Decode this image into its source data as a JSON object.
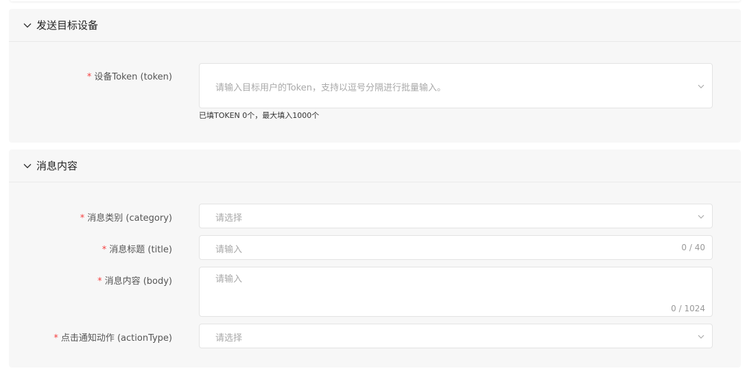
{
  "sections": [
    {
      "title": "发送目标设备",
      "fields": [
        {
          "label": "设备Token (token)",
          "placeholder": "请输入目标用户的Token，支持以逗号分隔进行批量输入。",
          "hint": "已填TOKEN 0个，最大填入1000个"
        }
      ]
    },
    {
      "title": "消息内容",
      "fields": [
        {
          "label": "消息类别 (category)",
          "placeholder": "请选择"
        },
        {
          "label": "消息标题 (title)",
          "placeholder": "请输入",
          "counter": "0 / 40"
        },
        {
          "label": "消息内容 (body)",
          "placeholder": "请输入",
          "counter": "0 / 1024"
        },
        {
          "label": "点击通知动作 (actionType)",
          "placeholder": "请选择"
        }
      ]
    }
  ],
  "required_mark": "*",
  "colors": {
    "required": "#f53f3f",
    "section_bg": "#f7f7f7"
  },
  "icons": {
    "collapse": "chevron-down-icon",
    "select_arrow": "chevron-down-icon"
  }
}
